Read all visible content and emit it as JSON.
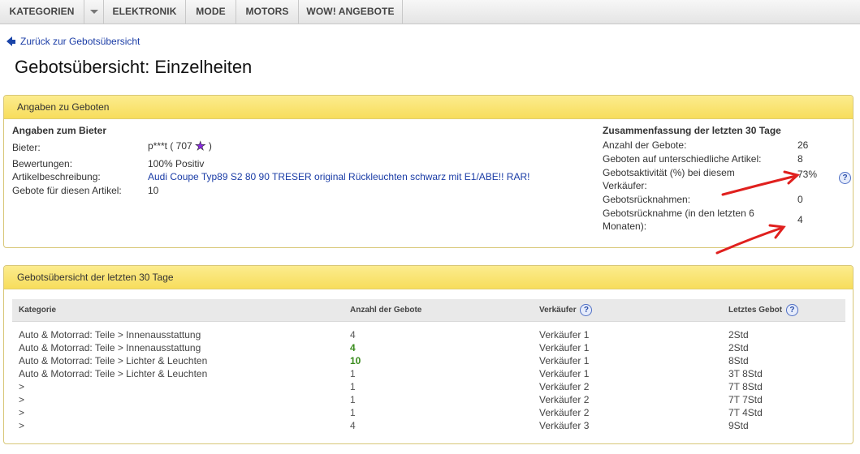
{
  "nav": {
    "items": [
      "KATEGORIEN",
      "ELEKTRONIK",
      "MODE",
      "MOTORS",
      "WOW! ANGEBOTE"
    ]
  },
  "back_link": "Zurück zur Gebotsübersicht",
  "page_title": "Gebotsübersicht: Einzelheiten",
  "panel_bids": {
    "title": "Angaben zu Geboten",
    "bidder_section": {
      "title": "Angaben zum Bieter",
      "bidder_label": "Bieter:",
      "bidder_value": "p***t ( 707",
      "bidder_close": ")",
      "ratings_label": "Bewertungen:",
      "ratings_value": "100% Positiv",
      "item_label": "Artikelbeschreibung:",
      "item_value": "Audi Coupe Typ89 S2 80 90 TRESER original Rückleuchten schwarz mit E1/ABE!! RAR!",
      "bids_label": "Gebote für diesen Artikel:",
      "bids_value": "10"
    },
    "summary_section": {
      "title": "Zusammenfassung der letzten 30 Tage",
      "rows": [
        {
          "label": "Anzahl der Gebote:",
          "value": "26"
        },
        {
          "label": "Geboten auf unterschiedliche Artikel:",
          "value": "8"
        },
        {
          "label": "Gebotsaktivität (%) bei diesem",
          "label2": "Verkäufer:",
          "value": "73%"
        },
        {
          "label": "Gebotsrücknahmen:",
          "value": "0"
        },
        {
          "label": "Gebotsrücknahme (in den letzten 6",
          "label2": "Monaten):",
          "value": "4"
        }
      ],
      "help_icon": "question-icon"
    }
  },
  "panel_overview": {
    "title": "Gebotsübersicht der letzten 30 Tage",
    "columns": [
      "Kategorie",
      "Anzahl der Gebote",
      "Verkäufer",
      "Letztes Gebot"
    ],
    "rows": [
      {
        "category": "Auto & Motorrad: Teile > Innenausstattung",
        "count": "4",
        "highlight": false,
        "seller": "Verkäufer 1",
        "last": "2Std"
      },
      {
        "category": "Auto & Motorrad: Teile > Innenausstattung",
        "count": "4",
        "highlight": true,
        "seller": "Verkäufer 1",
        "last": "2Std"
      },
      {
        "category": "Auto & Motorrad: Teile > Lichter & Leuchten",
        "count": "10",
        "highlight": true,
        "seller": "Verkäufer 1",
        "last": "8Std"
      },
      {
        "category": "Auto & Motorrad: Teile > Lichter & Leuchten",
        "count": "1",
        "highlight": false,
        "seller": "Verkäufer 1",
        "last": "3T 8Std"
      },
      {
        "category": ">",
        "count": "1",
        "highlight": false,
        "seller": "Verkäufer 2",
        "last": "7T 8Std"
      },
      {
        "category": ">",
        "count": "1",
        "highlight": false,
        "seller": "Verkäufer 2",
        "last": "7T 7Std"
      },
      {
        "category": ">",
        "count": "1",
        "highlight": false,
        "seller": "Verkäufer 2",
        "last": "7T 4Std"
      },
      {
        "category": ">",
        "count": "4",
        "highlight": false,
        "seller": "Verkäufer 3",
        "last": "9Std"
      }
    ]
  },
  "colors": {
    "link": "#1a3ca6",
    "panel_header": "#f9e57a",
    "highlight_green": "#3a8c1e",
    "annotation_red": "#e0201e"
  }
}
